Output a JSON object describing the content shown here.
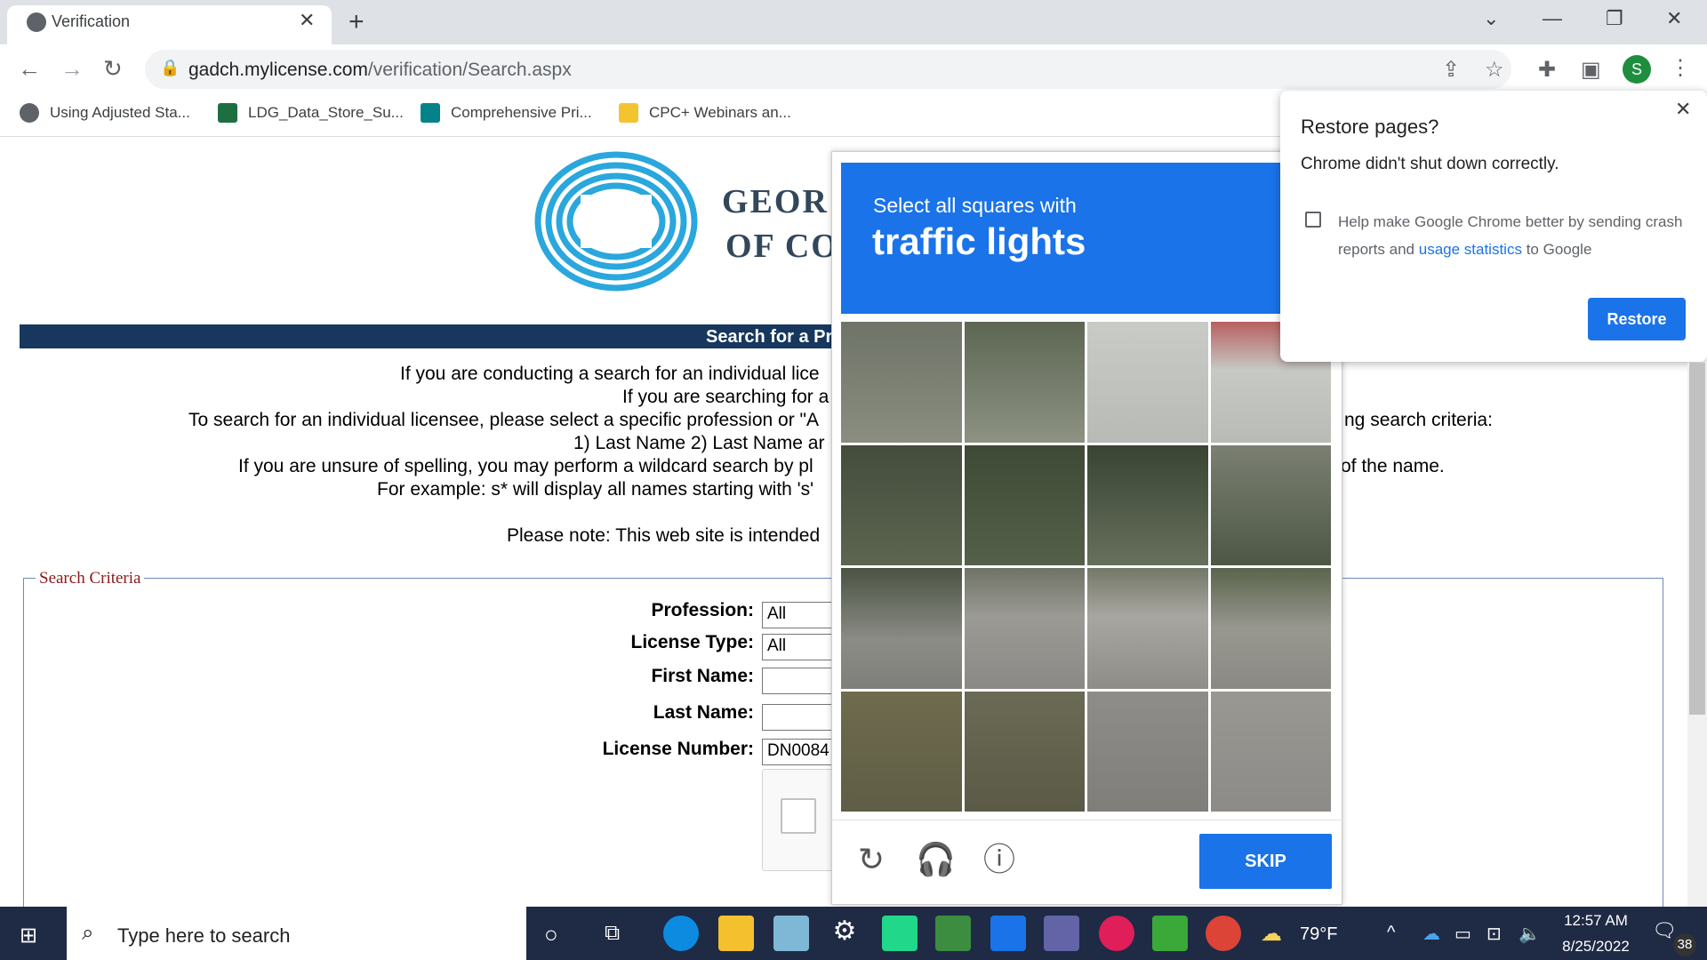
{
  "browser": {
    "tab_title": "Verification",
    "url_host": "gadch.mylicense.com",
    "url_path": "/verification/Search.aspx",
    "avatar_letter": "S",
    "bookmarks": [
      {
        "label": "Using Adjusted Sta...",
        "color": "#5f6368"
      },
      {
        "label": "LDG_Data_Store_Su...",
        "color": "#1d6f42"
      },
      {
        "label": "Comprehensive Pri...",
        "color": "#038387"
      },
      {
        "label": "CPC+ Webinars an...",
        "color": "#f4c430"
      }
    ]
  },
  "page": {
    "logo_line1": "GEOR",
    "logo_line2": "OF CO",
    "banner": "Search for a Pro",
    "intro_lines": [
      "If you are conducting a search for an individual lice",
      "If you are searching for a",
      "To search for an individual licensee, please select a specific profession or \"A",
      "ng search criteria:",
      "1) Last Name 2) Last Name ar",
      "If you are unsure of spelling, you may perform a wildcard search by pl",
      "of the name.",
      "For example: s* will display all names starting with 's'",
      "Please note: This web site is intended"
    ],
    "criteria_legend": "Search Criteria",
    "fields": [
      {
        "label": "Profession:",
        "value": "All"
      },
      {
        "label": "License Type:",
        "value": "All"
      },
      {
        "label": "First Name:",
        "value": ""
      },
      {
        "label": "Last Name:",
        "value": ""
      },
      {
        "label": "License Number:",
        "value": "DN0084"
      }
    ]
  },
  "captcha": {
    "prompt_small": "Select all squares with",
    "prompt_big": "traffic lights",
    "skip_label": "SKIP",
    "header_color": "#1a73e8"
  },
  "restore": {
    "title": "Restore pages?",
    "message": "Chrome didn't shut down correctly.",
    "checkbox_text_pre": "Help make Google Chrome better by sending crash reports and ",
    "checkbox_link": "usage statistics",
    "checkbox_text_post": " to Google",
    "button_label": "Restore"
  },
  "taskbar": {
    "search_placeholder": "Type here to search",
    "weather": "79°F",
    "time": "12:57 AM",
    "date": "8/25/2022",
    "notification_count": "38"
  }
}
